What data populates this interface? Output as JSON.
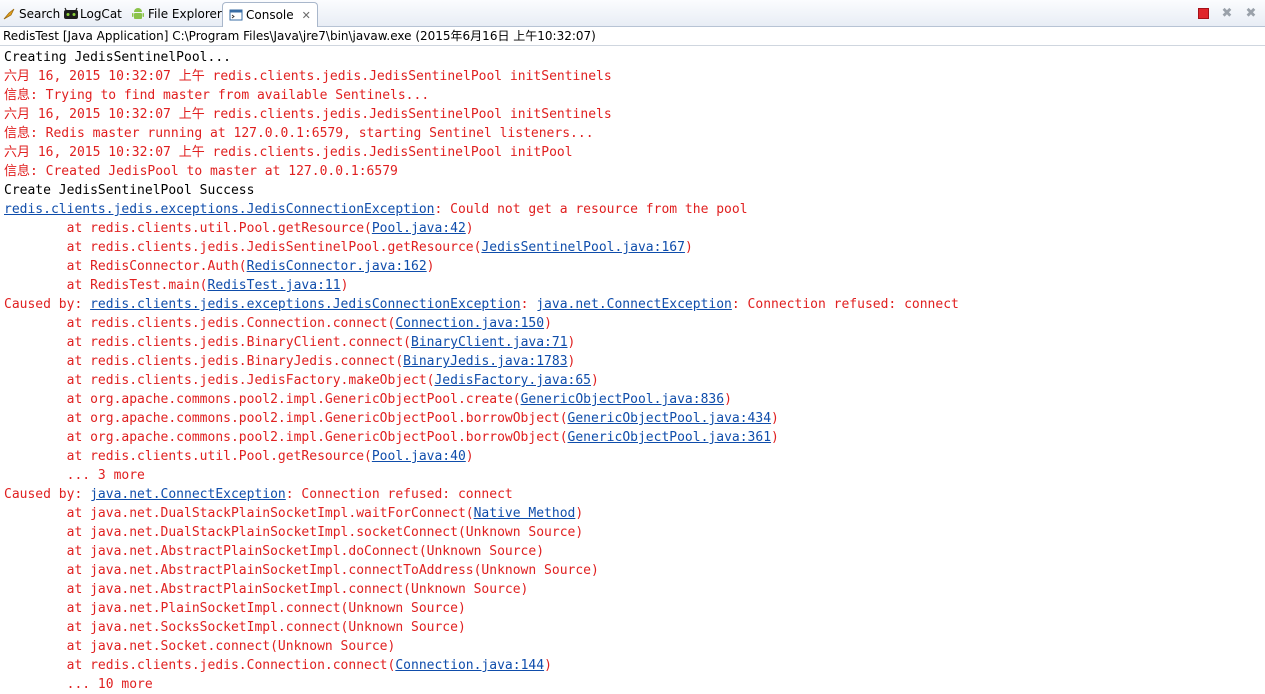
{
  "tabs": [
    {
      "name": "search",
      "label": "Search",
      "icon": "search-icon"
    },
    {
      "name": "logcat",
      "label": "LogCat",
      "icon": "logcat-icon"
    },
    {
      "name": "file-explorer",
      "label": "File Explorer",
      "icon": "android-icon"
    },
    {
      "name": "console",
      "label": "Console",
      "icon": "console-icon",
      "active": true
    }
  ],
  "toolbar": {
    "stop": "stop-icon",
    "remove": "remove-launch-icon",
    "remove_all": "remove-all-icon"
  },
  "description": "RedisTest [Java Application] C:\\Program Files\\Java\\jre7\\bin\\javaw.exe (2015年6月16日 上午10:32:07)",
  "colors": {
    "stderr": "#e02020",
    "stdout": "#000000",
    "link": "#0f4dab"
  },
  "lines": [
    [
      {
        "t": "Creating JedisSentinelPool...",
        "c": "k"
      }
    ],
    [
      {
        "t": "六月 16, 2015 10:32:07 上午 redis.clients.jedis.JedisSentinelPool initSentinels",
        "c": "r"
      }
    ],
    [
      {
        "t": "信息: Trying to find master from available Sentinels...",
        "c": "r"
      }
    ],
    [
      {
        "t": "六月 16, 2015 10:32:07 上午 redis.clients.jedis.JedisSentinelPool initSentinels",
        "c": "r"
      }
    ],
    [
      {
        "t": "信息: Redis master running at 127.0.0.1:6579, starting Sentinel listeners...",
        "c": "r"
      }
    ],
    [
      {
        "t": "六月 16, 2015 10:32:07 上午 redis.clients.jedis.JedisSentinelPool initPool",
        "c": "r"
      }
    ],
    [
      {
        "t": "信息: Created JedisPool to master at 127.0.0.1:6579",
        "c": "r"
      }
    ],
    [
      {
        "t": "Create JedisSentinelPool Success",
        "c": "k"
      }
    ],
    [
      {
        "t": "redis.clients.jedis.exceptions.JedisConnectionException",
        "c": "a"
      },
      {
        "t": ": Could not get a resource from the pool",
        "c": "r"
      }
    ],
    [
      {
        "t": "        at redis.clients.util.Pool.getResource(",
        "c": "r"
      },
      {
        "t": "Pool.java:42",
        "c": "a"
      },
      {
        "t": ")",
        "c": "r"
      }
    ],
    [
      {
        "t": "        at redis.clients.jedis.JedisSentinelPool.getResource(",
        "c": "r"
      },
      {
        "t": "JedisSentinelPool.java:167",
        "c": "a"
      },
      {
        "t": ")",
        "c": "r"
      }
    ],
    [
      {
        "t": "        at RedisConnector.Auth(",
        "c": "r"
      },
      {
        "t": "RedisConnector.java:162",
        "c": "a"
      },
      {
        "t": ")",
        "c": "r"
      }
    ],
    [
      {
        "t": "        at RedisTest.main(",
        "c": "r"
      },
      {
        "t": "RedisTest.java:11",
        "c": "a"
      },
      {
        "t": ")",
        "c": "r"
      }
    ],
    [
      {
        "t": "Caused by: ",
        "c": "r"
      },
      {
        "t": "redis.clients.jedis.exceptions.JedisConnectionException",
        "c": "a"
      },
      {
        "t": ": ",
        "c": "r"
      },
      {
        "t": "java.net.ConnectException",
        "c": "a"
      },
      {
        "t": ": Connection refused: connect",
        "c": "r"
      }
    ],
    [
      {
        "t": "        at redis.clients.jedis.Connection.connect(",
        "c": "r"
      },
      {
        "t": "Connection.java:150",
        "c": "a"
      },
      {
        "t": ")",
        "c": "r"
      }
    ],
    [
      {
        "t": "        at redis.clients.jedis.BinaryClient.connect(",
        "c": "r"
      },
      {
        "t": "BinaryClient.java:71",
        "c": "a"
      },
      {
        "t": ")",
        "c": "r"
      }
    ],
    [
      {
        "t": "        at redis.clients.jedis.BinaryJedis.connect(",
        "c": "r"
      },
      {
        "t": "BinaryJedis.java:1783",
        "c": "a"
      },
      {
        "t": ")",
        "c": "r"
      }
    ],
    [
      {
        "t": "        at redis.clients.jedis.JedisFactory.makeObject(",
        "c": "r"
      },
      {
        "t": "JedisFactory.java:65",
        "c": "a"
      },
      {
        "t": ")",
        "c": "r"
      }
    ],
    [
      {
        "t": "        at org.apache.commons.pool2.impl.GenericObjectPool.create(",
        "c": "r"
      },
      {
        "t": "GenericObjectPool.java:836",
        "c": "a"
      },
      {
        "t": ")",
        "c": "r"
      }
    ],
    [
      {
        "t": "        at org.apache.commons.pool2.impl.GenericObjectPool.borrowObject(",
        "c": "r"
      },
      {
        "t": "GenericObjectPool.java:434",
        "c": "a"
      },
      {
        "t": ")",
        "c": "r"
      }
    ],
    [
      {
        "t": "        at org.apache.commons.pool2.impl.GenericObjectPool.borrowObject(",
        "c": "r"
      },
      {
        "t": "GenericObjectPool.java:361",
        "c": "a"
      },
      {
        "t": ")",
        "c": "r"
      }
    ],
    [
      {
        "t": "        at redis.clients.util.Pool.getResource(",
        "c": "r"
      },
      {
        "t": "Pool.java:40",
        "c": "a"
      },
      {
        "t": ")",
        "c": "r"
      }
    ],
    [
      {
        "t": "        ... 3 more",
        "c": "r"
      }
    ],
    [
      {
        "t": "Caused by: ",
        "c": "r"
      },
      {
        "t": "java.net.ConnectException",
        "c": "a"
      },
      {
        "t": ": Connection refused: connect",
        "c": "r"
      }
    ],
    [
      {
        "t": "        at java.net.DualStackPlainSocketImpl.waitForConnect(",
        "c": "r"
      },
      {
        "t": "Native Method",
        "c": "a"
      },
      {
        "t": ")",
        "c": "r"
      }
    ],
    [
      {
        "t": "        at java.net.DualStackPlainSocketImpl.socketConnect(Unknown Source)",
        "c": "r"
      }
    ],
    [
      {
        "t": "        at java.net.AbstractPlainSocketImpl.doConnect(Unknown Source)",
        "c": "r"
      }
    ],
    [
      {
        "t": "        at java.net.AbstractPlainSocketImpl.connectToAddress(Unknown Source)",
        "c": "r"
      }
    ],
    [
      {
        "t": "        at java.net.AbstractPlainSocketImpl.connect(Unknown Source)",
        "c": "r"
      }
    ],
    [
      {
        "t": "        at java.net.PlainSocketImpl.connect(Unknown Source)",
        "c": "r"
      }
    ],
    [
      {
        "t": "        at java.net.SocksSocketImpl.connect(Unknown Source)",
        "c": "r"
      }
    ],
    [
      {
        "t": "        at java.net.Socket.connect(Unknown Source)",
        "c": "r"
      }
    ],
    [
      {
        "t": "        at redis.clients.jedis.Connection.connect(",
        "c": "r"
      },
      {
        "t": "Connection.java:144",
        "c": "a"
      },
      {
        "t": ")",
        "c": "r"
      }
    ],
    [
      {
        "t": "        ... 10 more",
        "c": "r"
      }
    ]
  ]
}
